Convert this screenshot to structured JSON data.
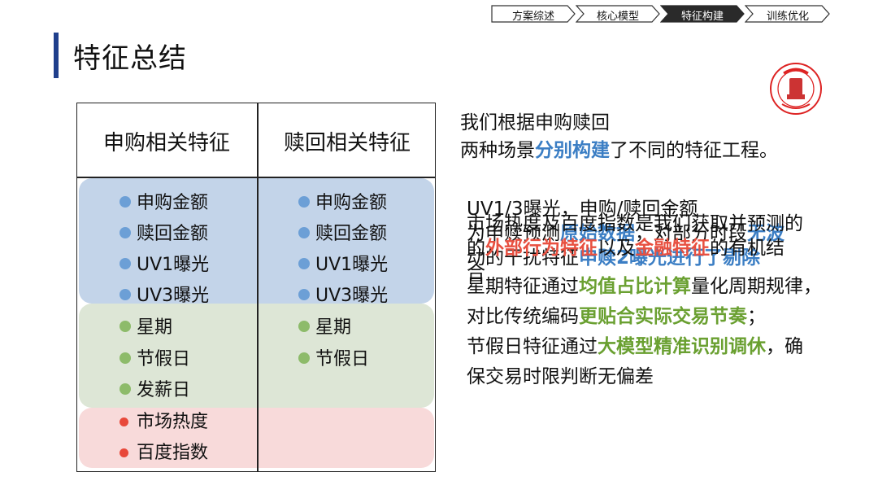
{
  "nav": {
    "items": [
      {
        "label": "方案综述",
        "active": false
      },
      {
        "label": "核心模型",
        "active": false
      },
      {
        "label": "特征构建",
        "active": true
      },
      {
        "label": "训练优化",
        "active": false
      }
    ]
  },
  "page": {
    "title": "特征总结"
  },
  "table": {
    "headers": [
      "申购相关特征",
      "赎回相关特征"
    ],
    "purchase_blue": [
      "申购金额",
      "赎回金额",
      "UV1曝光",
      "UV3曝光"
    ],
    "redeem_blue": [
      "申购金额",
      "赎回金额",
      "UV1曝光",
      "UV3曝光"
    ],
    "purchase_green": [
      "星期",
      "节假日",
      "发薪日"
    ],
    "redeem_green": [
      "星期",
      "节假日"
    ],
    "purchase_red": [
      "市场热度",
      "百度指数"
    ]
  },
  "summary": {
    "line1": "我们根据申购赎回",
    "line2_a": "两种场景",
    "line2_b": "分别构建",
    "line2_c": "了不同的特征工程。"
  },
  "layer_blue": {
    "l1": "UV1/3曝光，申购/赎回金额",
    "l2_a": "为申赎预测",
    "l2_b": "原始数据",
    "l2_c": "，对部分时段",
    "l2_d": "无波",
    "l3_a": "动的干扰特征",
    "l3_b": "申赎2曝光进行了剔除"
  },
  "layer_red": {
    "l1": "市场热度及百度指数是我们获取并预测的",
    "l2_a": "的",
    "l2_b": "外部行为特征",
    "l2_c": "以及",
    "l2_d": "金融特征",
    "l2_e": "的有机结",
    "l3": "合"
  },
  "layer_green": {
    "l1": "星期特征通过",
    "l1_b": "均值占比计算",
    "l1_c": "量化周期规律，",
    "l2_a": "对比传统编码",
    "l2_b": "更贴合实际交易节奏",
    "l2_c": "；",
    "l3_a": "节假日特征通过",
    "l3_b": "大模型精准识别调休",
    "l3_c": "，确",
    "l4": "保交易时限判断无偏差"
  },
  "colors": {
    "title_bar": "#1f3f8c",
    "blue": "#3b7ec4",
    "green": "#6aa031",
    "red": "#e85040",
    "dot_blue": "#6c9fd6",
    "dot_green": "#8dbb6a",
    "dot_red": "#e8483a"
  },
  "logo": {
    "icon": "university-seal-icon"
  }
}
